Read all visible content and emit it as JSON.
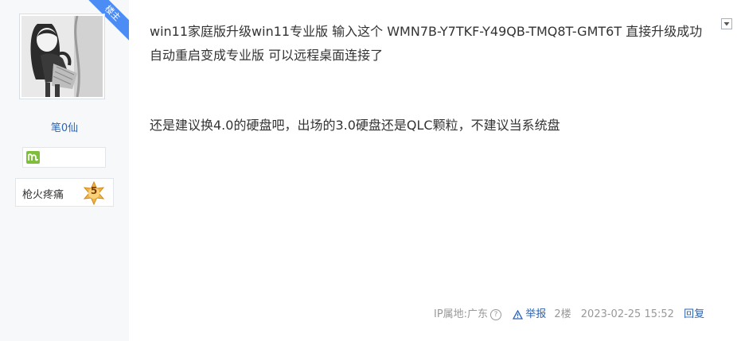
{
  "author": {
    "ribbon_label": "楼主",
    "username": "笔0仙",
    "level_name": "枪火疼痛",
    "level_number": "5"
  },
  "post": {
    "paragraph1": "win11家庭版升级win11专业版 输入这个 WMN7B-Y7TKF-Y49QB-TMQ8T-GMT6T 直接升级成功 自动重启变成专业版 可以远程桌面连接了",
    "paragraph2": "还是建议换4.0的硬盘吧，出场的3.0硬盘还是QLC颗粒，不建议当系统盘"
  },
  "footer": {
    "ip_location": "IP属地:广东",
    "help_glyph": "?",
    "report_label": "举报",
    "floor": "2楼",
    "timestamp": "2023-02-25 15:52",
    "reply_label": "回复"
  },
  "icons": {
    "ribbon": "op-ribbon",
    "badge": "member-badge-icon",
    "level": "level-star-icon",
    "menu": "chevron-down-icon",
    "report": "warning-triangle-icon",
    "help": "question-circle-icon"
  },
  "colors": {
    "link": "#2d64b3",
    "ribbon": "#4c8cf5",
    "sidebar_bg": "#f7f8fa",
    "badge": "#7fbe3c",
    "level_star": "#f0b54a"
  }
}
